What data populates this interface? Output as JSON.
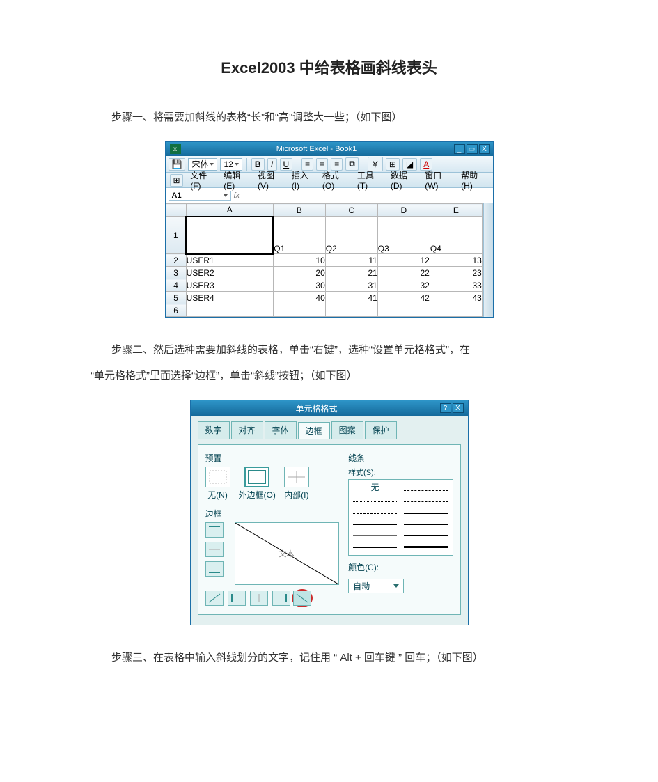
{
  "title": "Excel2003 中给表格画斜线表头",
  "steps": {
    "one": "步骤一、将需要加斜线的表格“长”和“高”调整大一些；（如下图）",
    "two_a": "步骤二、然后选种需要加斜线的表格，单击“右键”，选种“设置单元格格式”，在",
    "two_b": "“单元格格式”里面选择“边框”，单击“斜线”按钮；（如下图）",
    "three": "步骤三、在表格中输入斜线划分的文字，记住用 “ Alt + 回车键 ” 回车；（如下图）"
  },
  "excel": {
    "app_icon": "x",
    "title": "Microsoft Excel - Book1",
    "window_buttons": {
      "min": "_",
      "max": "▭",
      "close": "X"
    },
    "toolbar": {
      "save_icon": "save-icon",
      "font_name": "宋体",
      "font_size": "12",
      "bold": "B",
      "italic": "I",
      "underline": "U",
      "align_left": "≡",
      "align_center": "≡",
      "align_right": "≡",
      "merge": "⧉",
      "currency": "￥",
      "border": "⊞",
      "fill": "◪",
      "font_color": "A"
    },
    "menubar": {
      "app": "⊞",
      "items": [
        "文件(F)",
        "编辑(E)",
        "视图(V)",
        "插入(I)",
        "格式(O)",
        "工具(T)",
        "数据(D)",
        "窗口(W)",
        "帮助(H)"
      ]
    },
    "namebox": "A1",
    "fx_label": "fx",
    "columns": [
      "A",
      "B",
      "C",
      "D",
      "E"
    ],
    "header_row": [
      "",
      "Q1",
      "Q2",
      "Q3",
      "Q4"
    ],
    "rows": [
      {
        "n": "2",
        "cells": [
          "USER1",
          "10",
          "11",
          "12",
          "13"
        ]
      },
      {
        "n": "3",
        "cells": [
          "USER2",
          "20",
          "21",
          "22",
          "23"
        ]
      },
      {
        "n": "4",
        "cells": [
          "USER3",
          "30",
          "31",
          "32",
          "33"
        ]
      },
      {
        "n": "5",
        "cells": [
          "USER4",
          "40",
          "41",
          "42",
          "43"
        ]
      }
    ],
    "last_row_n": "6"
  },
  "dialog": {
    "title": "单元格格式",
    "help": "?",
    "close": "X",
    "tabs": [
      "数字",
      "对齐",
      "字体",
      "边框",
      "图案",
      "保护"
    ],
    "active_tab_index": 3,
    "preset_label": "预置",
    "preset_none": "无(N)",
    "preset_outline": "外边框(O)",
    "preset_inside": "内部(I)",
    "border_label": "边框",
    "preview_text": "文本",
    "lines_label": "线条",
    "style_label": "样式(S):",
    "style_none": "无",
    "color_label": "颜色(C):",
    "color_auto": "自动"
  }
}
